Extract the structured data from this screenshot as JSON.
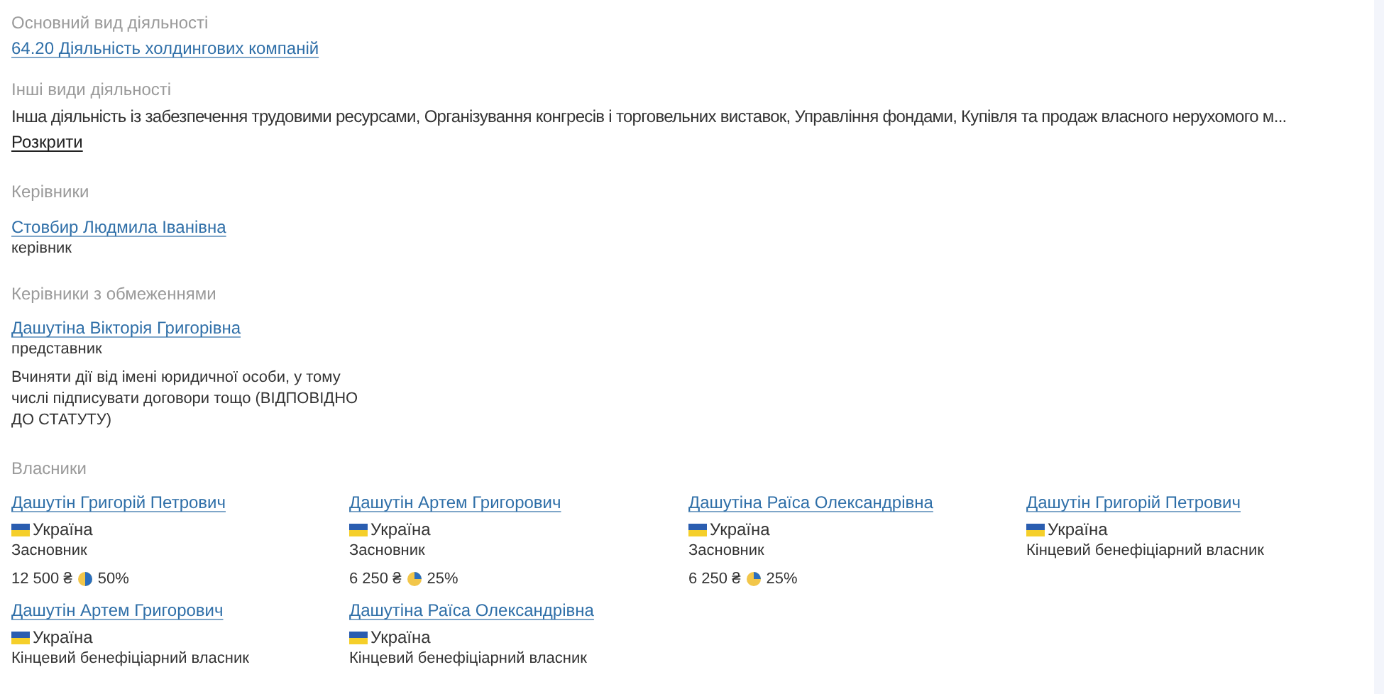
{
  "main_activity": {
    "title": "Основний вид діяльності",
    "link": "64.20 Діяльність холдингових компаній"
  },
  "other_activities": {
    "title": "Інші види діяльності",
    "text": "Інша діяльність із забезпечення трудовими ресурсами, Організування конгресів і торговельних виставок, Управління фондами, Купівля та продаж власного нерухомого м...",
    "expand_link": "Розкрити"
  },
  "managers": {
    "title": "Керівники",
    "people": [
      {
        "name": "Стовбир Людмила Іванівна",
        "role": "керівник"
      }
    ]
  },
  "restricted_managers": {
    "title": "Керівники з обмеженнями",
    "people": [
      {
        "name": "Дашутіна Вікторія Григорівна",
        "role": "представник",
        "note": "Вчиняти дії від імені юридичної особи, у тому числі підписувати договори тощо (ВІДПОВІДНО ДО СТАТУТУ)"
      }
    ]
  },
  "owners": {
    "title": "Власники",
    "items": [
      {
        "name": "Дашутін Григорій Петрович",
        "country": "Україна",
        "role": "Засновник",
        "amount": "12 500 ₴",
        "share": {
          "kind": "half",
          "text": "50%"
        }
      },
      {
        "name": "Дашутін Артем Григорович",
        "country": "Україна",
        "role": "Засновник",
        "amount": "6 250 ₴",
        "share": {
          "kind": "quarter",
          "text": "25%"
        }
      },
      {
        "name": "Дашутіна Раїса Олександрівна",
        "country": "Україна",
        "role": "Засновник",
        "amount": "6 250 ₴",
        "share": {
          "kind": "quarter",
          "text": "25%"
        }
      },
      {
        "name": "Дашутін Григорій Петрович",
        "country": "Україна",
        "role": "Кінцевий бенефіціарний власник"
      },
      {
        "name": "Дашутін Артем Григорович",
        "country": "Україна",
        "role": "Кінцевий бенефіціарний власник"
      },
      {
        "name": "Дашутіна Раїса Олександрівна",
        "country": "Україна",
        "role": "Кінцевий бенефіціарний власник"
      }
    ]
  }
}
